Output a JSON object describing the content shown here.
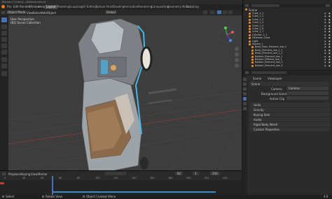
{
  "titlebar": {
    "title": "Blender [C:\\Users\\...\\delorean.blend]"
  },
  "menu": [
    "File",
    "Edit",
    "Render",
    "Window",
    "Help"
  ],
  "workspaces": [
    {
      "label": "Layout",
      "active": true
    },
    {
      "label": "Modeling",
      "active": false
    },
    {
      "label": "Sculpting",
      "active": false
    },
    {
      "label": "UV Editing",
      "active": false
    },
    {
      "label": "Texture Paint",
      "active": false
    },
    {
      "label": "Shading",
      "active": false
    },
    {
      "label": "Animation",
      "active": false
    },
    {
      "label": "Rendering",
      "active": false
    },
    {
      "label": "Compositing",
      "active": false
    },
    {
      "label": "Geometry Nodes",
      "active": false
    },
    {
      "label": "Scripting",
      "active": false
    }
  ],
  "viewport_header": {
    "mode": "Object Mode",
    "view": "View",
    "select": "Select",
    "add": "Add",
    "object": "Object",
    "transform": "Global"
  },
  "viewport_overlay": {
    "line1": "User Perspective",
    "line2": "(82) Scene Collection"
  },
  "outliner": {
    "scene_label": "Scene",
    "view_layer": "ViewLayer",
    "items": [
      {
        "name": "Cube_1_1",
        "depth": 1
      },
      {
        "name": "Cube_1_2",
        "depth": 1
      },
      {
        "name": "Cube_1_3",
        "depth": 1
      },
      {
        "name": "Cube_1_4",
        "depth": 1
      },
      {
        "name": "Cube_1_5",
        "depth": 1
      },
      {
        "name": "Cube_1_6",
        "depth": 1
      },
      {
        "name": "Cube_1_7",
        "depth": 1
      },
      {
        "name": "Cylinder_1_1",
        "depth": 1
      },
      {
        "name": "Delorean_Case",
        "depth": 1
      },
      {
        "name": "Light",
        "depth": 1
      },
      {
        "name": "Sphere_1",
        "depth": 1
      },
      {
        "name": "Body_Rear_Element_low_1",
        "depth": 2
      },
      {
        "name": "Body_Element_low_1_1",
        "depth": 2
      },
      {
        "name": "Body_Element_low_1_2",
        "depth": 2
      },
      {
        "name": "Bottom_Element_low_1",
        "depth": 2
      },
      {
        "name": "Bottom_Diffuser_low_1",
        "depth": 2
      },
      {
        "name": "Bottom_Element_low_2",
        "depth": 2
      },
      {
        "name": "Bottom_Element_low_3",
        "depth": 2
      }
    ]
  },
  "properties": {
    "scene_name": "Scene",
    "layer_name": "ViewLayer",
    "panel_scene": "Scene",
    "camera_label": "Camera",
    "camera_value": "Camera",
    "bg_label": "Background Scene",
    "clip_label": "Active Clip",
    "sections": [
      "Units",
      "Gravity",
      "Keying Sets",
      "Audio",
      "Rigid Body World",
      "Custom Properties"
    ]
  },
  "timeline": {
    "playback": "Playback",
    "keying": "Keying",
    "view": "View",
    "marker": "Marker",
    "frames": [
      "0",
      "20",
      "40",
      "60",
      "80",
      "100",
      "120",
      "140",
      "160",
      "180",
      "200",
      "220",
      "240"
    ],
    "current_frame": "82",
    "start": "1",
    "end": "250"
  },
  "statusbar": {
    "left": "Select",
    "mid1": "Rotate View",
    "mid2": "Object Context Menu",
    "right": "4.0"
  },
  "colors": {
    "accent": "#4772b3",
    "orange": "#e08b2a",
    "timeline_bar": "#3c8bd0",
    "model": "#9ea3a8"
  }
}
